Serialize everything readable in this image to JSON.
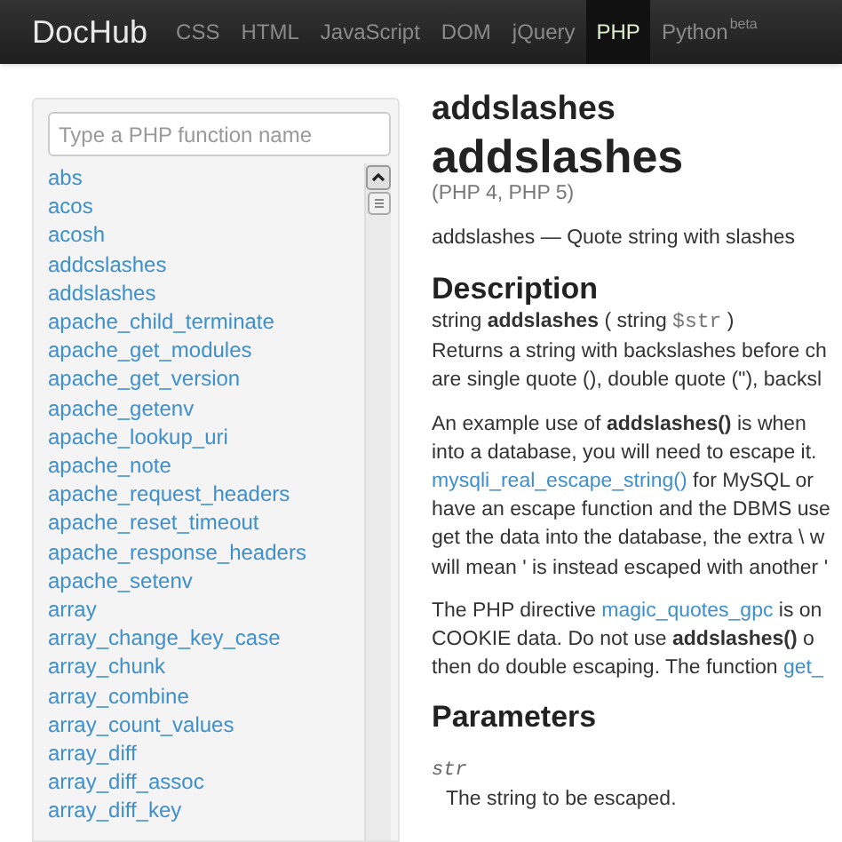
{
  "navbar": {
    "brand": "DocHub",
    "items": [
      {
        "label": "CSS",
        "selected": false
      },
      {
        "label": "HTML",
        "selected": false
      },
      {
        "label": "JavaScript",
        "selected": false
      },
      {
        "label": "DOM",
        "selected": false
      },
      {
        "label": "jQuery",
        "selected": false
      },
      {
        "label": "PHP",
        "selected": true
      },
      {
        "label": "Python",
        "badge": "beta",
        "selected": false
      }
    ]
  },
  "sidebar": {
    "search": {
      "placeholder": "Type a PHP function name"
    },
    "items": [
      "abs",
      "acos",
      "acosh",
      "addcslashes",
      "addslashes",
      "apache_child_terminate",
      "apache_get_modules",
      "apache_get_version",
      "apache_getenv",
      "apache_lookup_uri",
      "apache_note",
      "apache_request_headers",
      "apache_reset_timeout",
      "apache_response_headers",
      "apache_setenv",
      "array",
      "array_change_key_case",
      "array_chunk",
      "array_combine",
      "array_count_values",
      "array_diff",
      "array_diff_assoc",
      "array_diff_key"
    ]
  },
  "content": {
    "title": "addslashes",
    "heading": "addslashes",
    "versions": "(PHP 4, PHP 5)",
    "summary": "addslashes — Quote string with slashes",
    "description_heading": "Description",
    "signature": {
      "type": "string",
      "name": "addslashes",
      "params": "( string",
      "var": "$str",
      "close": ")"
    },
    "paragraphs": [
      [
        [
          {
            "text": "Returns a string with backslashes before ch"
          }
        ],
        [
          {
            "text": "are single quote (), double quote (\"), backsl"
          }
        ]
      ],
      [
        [
          {
            "text": "An example use of **addslashes()** is when"
          }
        ],
        [
          {
            "text": "into a database, you will need to escape it."
          }
        ],
        [
          {
            "text": "mysqli_real_escape_string()",
            "kind": "link"
          },
          {
            "text": " for MySQL or"
          }
        ],
        [
          {
            "text": "have an escape function and the DBMS use"
          }
        ],
        [
          {
            "text": "get the data into the database, the extra \\ w"
          }
        ],
        [
          {
            "text": "will mean ' is instead escaped with another '"
          }
        ]
      ],
      [
        [
          {
            "text": "The PHP directive "
          },
          {
            "text": "magic_quotes_gpc",
            "kind": "link"
          },
          {
            "text": " is on"
          }
        ],
        [
          {
            "text": "COOKIE data. Do not use **addslashes()** o"
          }
        ],
        [
          {
            "text": "then do double escaping. The function "
          },
          {
            "text": "get_",
            "kind": "link"
          }
        ]
      ]
    ],
    "parameters_heading": "Parameters",
    "parameter": {
      "name": "str",
      "description": "The string to be escaped."
    }
  }
}
